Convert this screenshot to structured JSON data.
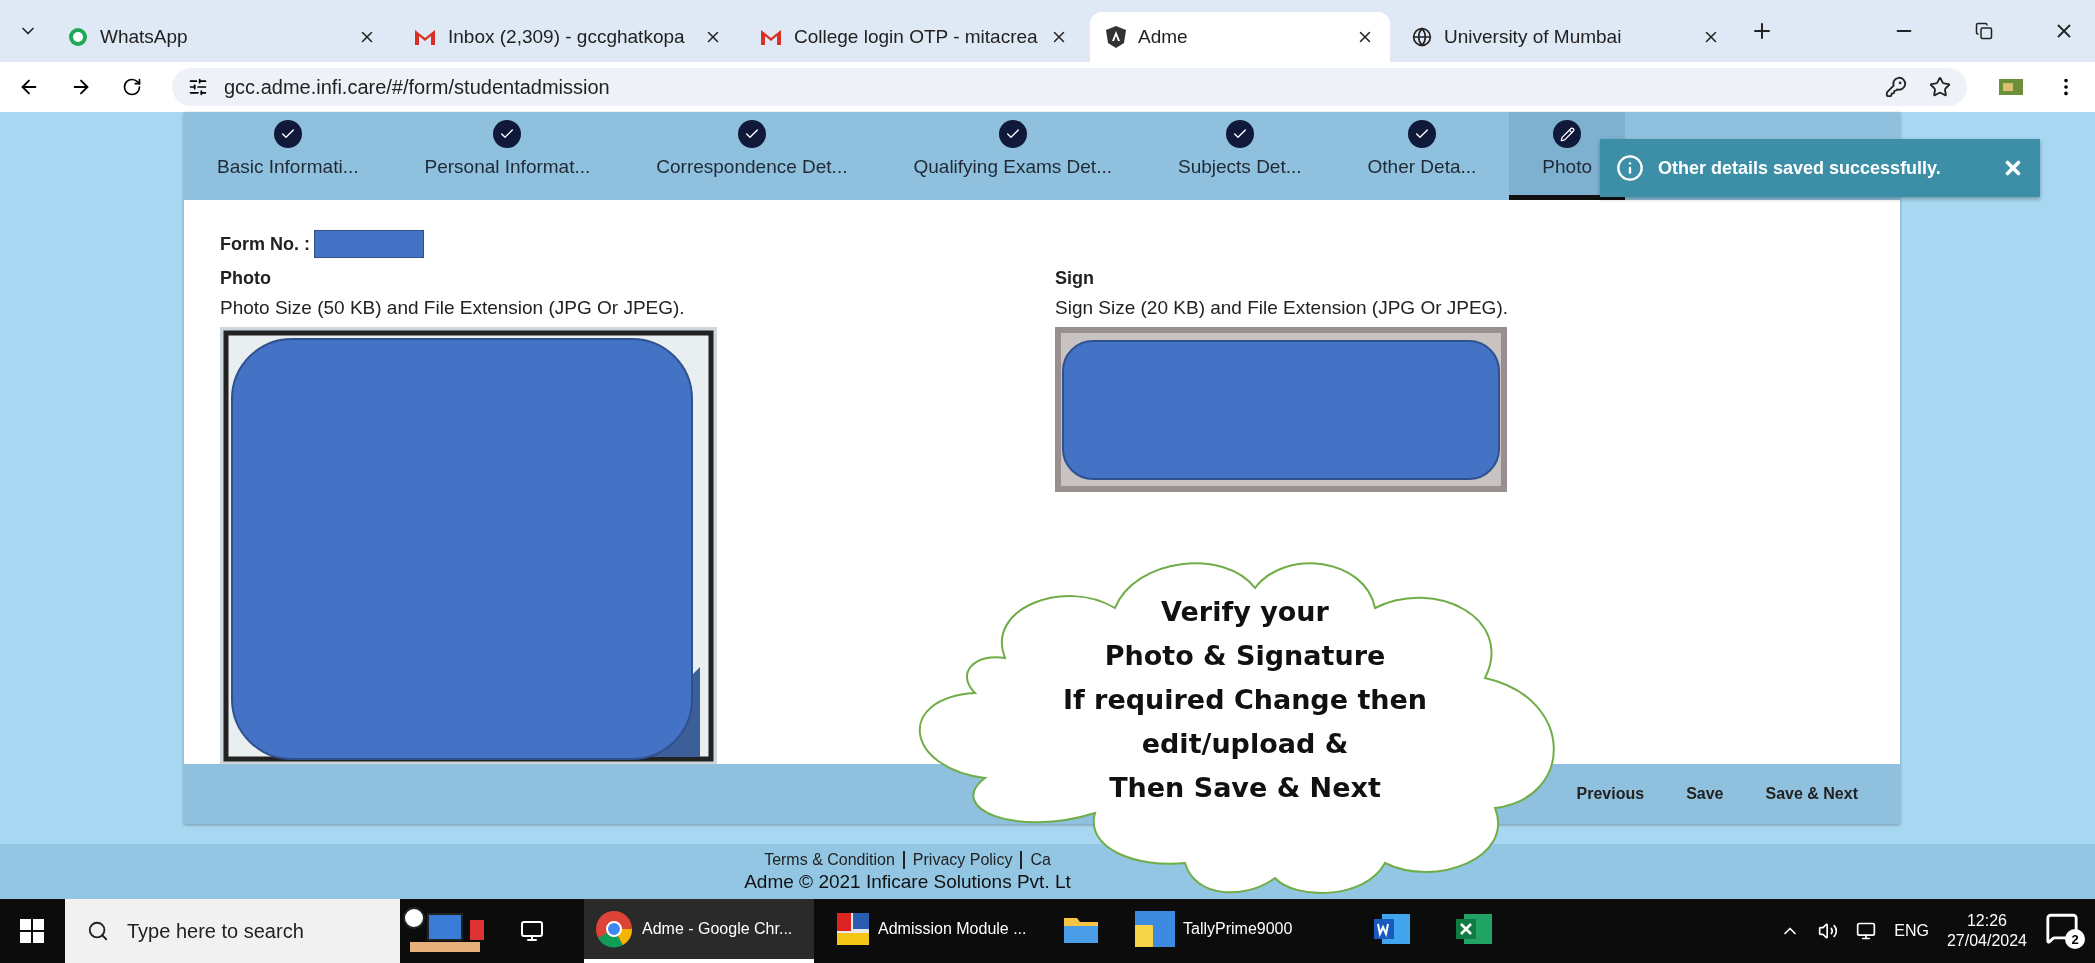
{
  "browser": {
    "tabs": [
      {
        "title": "WhatsApp",
        "kind": "chat",
        "selected": false
      },
      {
        "title": "Inbox (2,309) - gccghatkopa",
        "kind": "mail",
        "selected": false
      },
      {
        "title": "College login OTP - mitacrea",
        "kind": "mail",
        "selected": false
      },
      {
        "title": "Adme",
        "kind": "app",
        "selected": true
      },
      {
        "title": "University of Mumbai",
        "kind": "web",
        "selected": false
      }
    ],
    "url": "gcc.adme.infi.care/#/form/studentadmission"
  },
  "steps": [
    {
      "label": "Basic Informati...",
      "kind": "done",
      "selected": false
    },
    {
      "label": "Personal Informat...",
      "kind": "done",
      "selected": false
    },
    {
      "label": "Correspondence Det...",
      "kind": "done",
      "selected": false
    },
    {
      "label": "Qualifying Exams Det...",
      "kind": "done",
      "selected": false
    },
    {
      "label": "Subjects Det...",
      "kind": "done",
      "selected": false
    },
    {
      "label": "Other Deta...",
      "kind": "done",
      "selected": false
    },
    {
      "label": "Photo",
      "kind": "edit",
      "selected": true
    }
  ],
  "toast": {
    "message": "Other details saved successfully."
  },
  "form": {
    "form_no_label": "Form No. :",
    "photo": {
      "title": "Photo",
      "hint": "Photo Size (50 KB) and File Extension (JPG Or JPEG)."
    },
    "sign": {
      "title": "Sign",
      "hint": "Sign Size (20 KB) and File Extension (JPG Or JPEG)."
    }
  },
  "actions": [
    "Previous",
    "Save",
    "Save & Next"
  ],
  "footer": {
    "links": [
      "Terms & Condition",
      "Privacy Policy",
      "Ca"
    ],
    "copyright": "Adme © 2021 Inficare Solutions Pvt. Lt"
  },
  "callout": {
    "lines": [
      "Verify your",
      "Photo & Signature",
      "If required Change then",
      "edit/upload &",
      "Then Save & Next"
    ]
  },
  "taskbar": {
    "search_placeholder": "Type here to search",
    "apps": [
      {
        "label": "Adme - Google Chr...",
        "kind": "browser",
        "selected": true
      },
      {
        "label": "Admission Module ...",
        "kind": "window",
        "selected": false
      },
      {
        "kind": "folder",
        "selected": false
      },
      {
        "label": "TallyPrime9000",
        "kind": "tally",
        "selected": false
      },
      {
        "kind": "document",
        "selected": false
      },
      {
        "kind": "sheet",
        "selected": false
      }
    ],
    "language": "ENG",
    "time": "12:26",
    "date": "27/04/2024",
    "notifications": "2"
  }
}
